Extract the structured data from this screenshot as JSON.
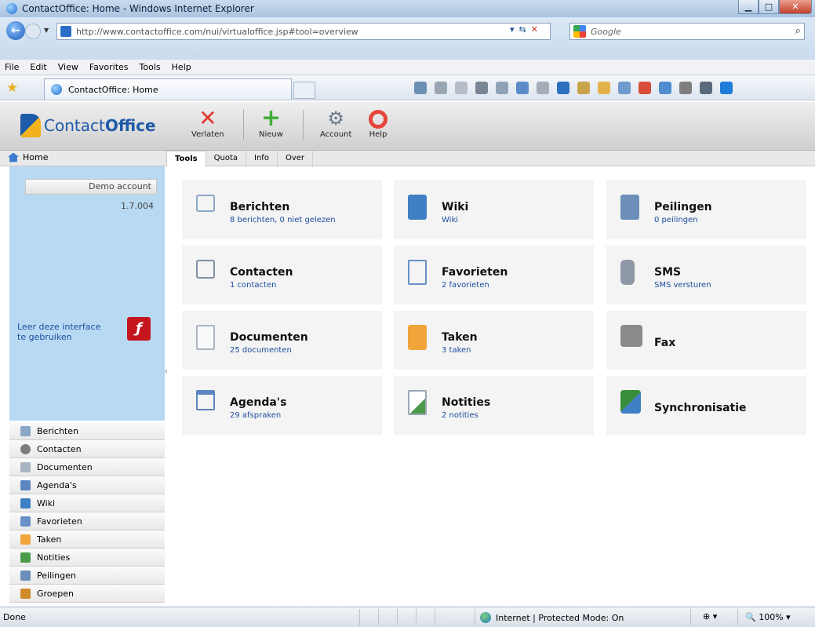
{
  "window": {
    "title": "ContactOffice: Home - Windows Internet Explorer"
  },
  "address": {
    "url": "http://www.contactoffice.com/nui/virtualoffice.jsp#tool=overview",
    "search_placeholder": "Google"
  },
  "menu": {
    "items": [
      "File",
      "Edit",
      "View",
      "Favorites",
      "Tools",
      "Help"
    ]
  },
  "browser_tab": {
    "label": "ContactOffice: Home"
  },
  "app": {
    "logo_regular": "Contact",
    "logo_bold": "Office",
    "toolbar": [
      {
        "label": "Verlaten",
        "icon": "close-x-icon"
      },
      {
        "label": "Nieuw",
        "icon": "plus-icon"
      },
      {
        "label": "Account",
        "icon": "gear-check-icon"
      },
      {
        "label": "Help",
        "icon": "lifebuoy-icon"
      }
    ],
    "home_label": "Home",
    "tabs": [
      "Tools",
      "Quota",
      "Info",
      "Over"
    ],
    "active_tab": "Tools"
  },
  "sidebar": {
    "account_name": "Demo account",
    "version": "1.7.004",
    "learn_text": "Leer deze interface te gebruiken",
    "modules": [
      {
        "label": "Berichten",
        "icon": "envelope-icon",
        "color": "#8aa7c8"
      },
      {
        "label": "Contacten",
        "icon": "person-icon",
        "color": "#7d7d7d"
      },
      {
        "label": "Documenten",
        "icon": "document-icon",
        "color": "#a9b4c2"
      },
      {
        "label": "Agenda's",
        "icon": "calendar-icon",
        "color": "#5b86c2"
      },
      {
        "label": "Wiki",
        "icon": "wiki-icon",
        "color": "#3f7fc4"
      },
      {
        "label": "Favorieten",
        "icon": "bookmark-icon",
        "color": "#6a90c8"
      },
      {
        "label": "Taken",
        "icon": "clipboard-icon",
        "color": "#f0a43a"
      },
      {
        "label": "Notities",
        "icon": "note-pencil-icon",
        "color": "#4a9a4a"
      },
      {
        "label": "Peilingen",
        "icon": "poll-icon",
        "color": "#6b8fb8"
      },
      {
        "label": "Groepen",
        "icon": "people-icon",
        "color": "#d08a2a"
      }
    ]
  },
  "tools": [
    {
      "title": "Berichten",
      "sub": "8 berichten, 0 niet gelezen",
      "icon": "envelope-icon",
      "color": "#8aa7c8"
    },
    {
      "title": "Wiki",
      "sub": "Wiki",
      "icon": "wiki-icon",
      "color": "#3f7fc4"
    },
    {
      "title": "Peilingen",
      "sub": "0 peilingen",
      "icon": "poll-icon",
      "color": "#6b8fb8"
    },
    {
      "title": "Contacten",
      "sub": "1 contacten",
      "icon": "contact-card-icon",
      "color": "#7d8fa6"
    },
    {
      "title": "Favorieten",
      "sub": "2 favorieten",
      "icon": "bookmark-icon",
      "color": "#6a90c8"
    },
    {
      "title": "SMS",
      "sub": "SMS versturen",
      "icon": "mobile-phone-icon",
      "color": "#8e98a6"
    },
    {
      "title": "Documenten",
      "sub": "25 documenten",
      "icon": "document-icon",
      "color": "#a9b4c2"
    },
    {
      "title": "Taken",
      "sub": "3 taken",
      "icon": "clipboard-icon",
      "color": "#f0a43a"
    },
    {
      "title": "Fax",
      "sub": "",
      "icon": "fax-icon",
      "color": "#8a8a8a"
    },
    {
      "title": "Agenda's",
      "sub": "29 afspraken",
      "icon": "calendar-icon",
      "color": "#5b86c2"
    },
    {
      "title": "Notities",
      "sub": "2 notities",
      "icon": "note-pencil-icon",
      "color": "#4a9a4a"
    },
    {
      "title": "Synchronisatie",
      "sub": "",
      "icon": "sync-icon",
      "color": "#3a8d3a"
    }
  ],
  "status": {
    "done": "Done",
    "zone": "Internet | Protected Mode: On",
    "zoom": "100%"
  }
}
